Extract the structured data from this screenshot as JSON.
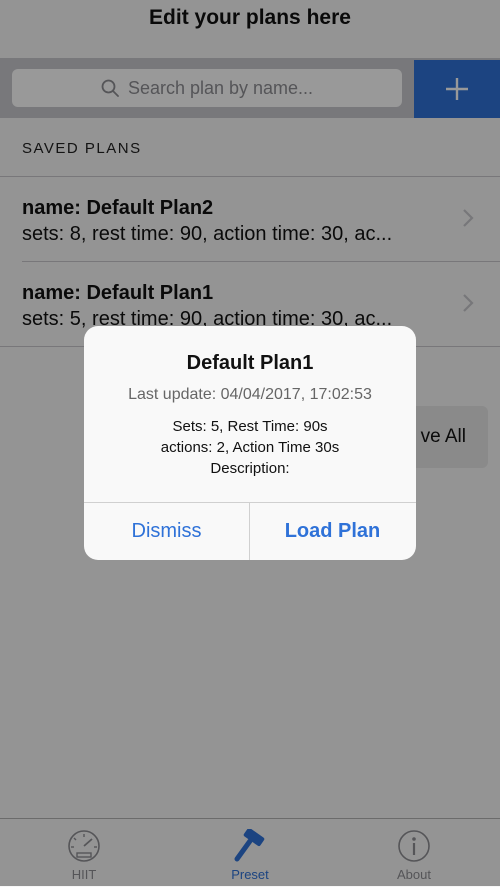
{
  "header": {
    "title": "Edit your plans here"
  },
  "search": {
    "placeholder": "Search plan by name..."
  },
  "add_button": {
    "icon": "plus-icon"
  },
  "section": {
    "title": "SAVED PLANS"
  },
  "plans": [
    {
      "name": "name: Default Plan2",
      "detail": "sets: 8, rest time: 90, action time: 30, ac..."
    },
    {
      "name": "name: Default Plan1",
      "detail": "sets: 5, rest time: 90, action time: 30, ac..."
    }
  ],
  "remove_all": {
    "label": "ve All"
  },
  "alert": {
    "title": "Default Plan1",
    "subtitle": "Last update: 04/04/2017, 17:02:53",
    "lines": [
      "Sets: 5, Rest Time: 90s",
      "actions: 2, Action Time 30s",
      "Description:"
    ],
    "dismiss": "Dismiss",
    "load": "Load Plan"
  },
  "tabs": [
    {
      "label": "HIIT",
      "icon": "speedometer-icon",
      "active": false
    },
    {
      "label": "Preset",
      "icon": "hammer-icon",
      "active": true
    },
    {
      "label": "About",
      "icon": "info-icon",
      "active": false
    }
  ],
  "colors": {
    "accent": "#2f72d8",
    "search_bar": "#c8c8cd",
    "overlay": "rgba(0,0,0,0.4)"
  }
}
